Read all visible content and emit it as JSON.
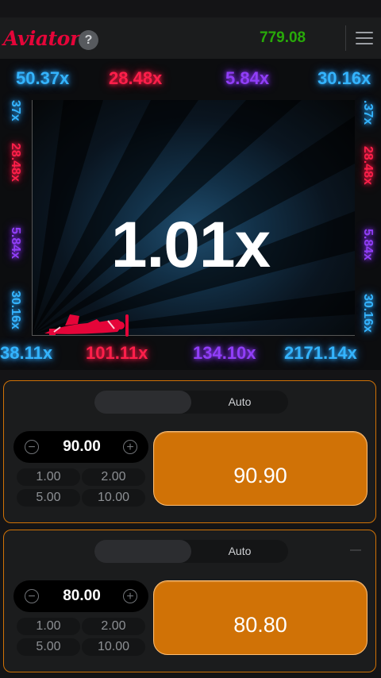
{
  "header": {
    "logo": "Aviator",
    "help": "?",
    "balance": "779.08"
  },
  "game": {
    "multiplier": "1.01x",
    "top_row": [
      {
        "text": "50.37x",
        "color": "blue"
      },
      {
        "text": "28.48x",
        "color": "red"
      },
      {
        "text": "5.84x",
        "color": "purple"
      },
      {
        "text": "30.16x",
        "color": "blue"
      }
    ],
    "bottom_row": [
      {
        "text": "38.11x",
        "color": "blue"
      },
      {
        "text": "101.11x",
        "color": "red"
      },
      {
        "text": "134.10x",
        "color": "purple"
      },
      {
        "text": "2171.14x",
        "color": "blue"
      }
    ],
    "left_col": [
      {
        "text": "37x",
        "color": "blue"
      },
      {
        "text": "28.48x",
        "color": "red"
      },
      {
        "text": "5.84x",
        "color": "purple"
      },
      {
        "text": "30.16x",
        "color": "blue"
      }
    ],
    "right_col": [
      {
        "text": ".37x",
        "color": "blue"
      },
      {
        "text": "28.48x",
        "color": "red"
      },
      {
        "text": "5.84x",
        "color": "purple"
      },
      {
        "text": "30.16x",
        "color": "blue"
      }
    ],
    "plane_icon": "red-propeller-plane-icon"
  },
  "panels": [
    {
      "tab_bet": "",
      "tab_auto": "Auto",
      "bet_value": "90.00",
      "minus": "−",
      "plus": "+",
      "chips": [
        "1.00",
        "2.00",
        "5.00",
        "10.00"
      ],
      "action_amount": "90.90"
    },
    {
      "tab_bet": "",
      "tab_auto": "Auto",
      "bet_value": "80.00",
      "minus": "−",
      "plus": "+",
      "chips": [
        "1.00",
        "2.00",
        "5.00",
        "10.00"
      ],
      "action_amount": "80.80"
    }
  ],
  "colors": {
    "accent_orange": "#d07206",
    "balance_green": "#28a909",
    "logo_red": "#e50539",
    "glow_blue": "#34b4ff",
    "glow_red": "#ff1f4a",
    "glow_purple": "#913ef8"
  }
}
